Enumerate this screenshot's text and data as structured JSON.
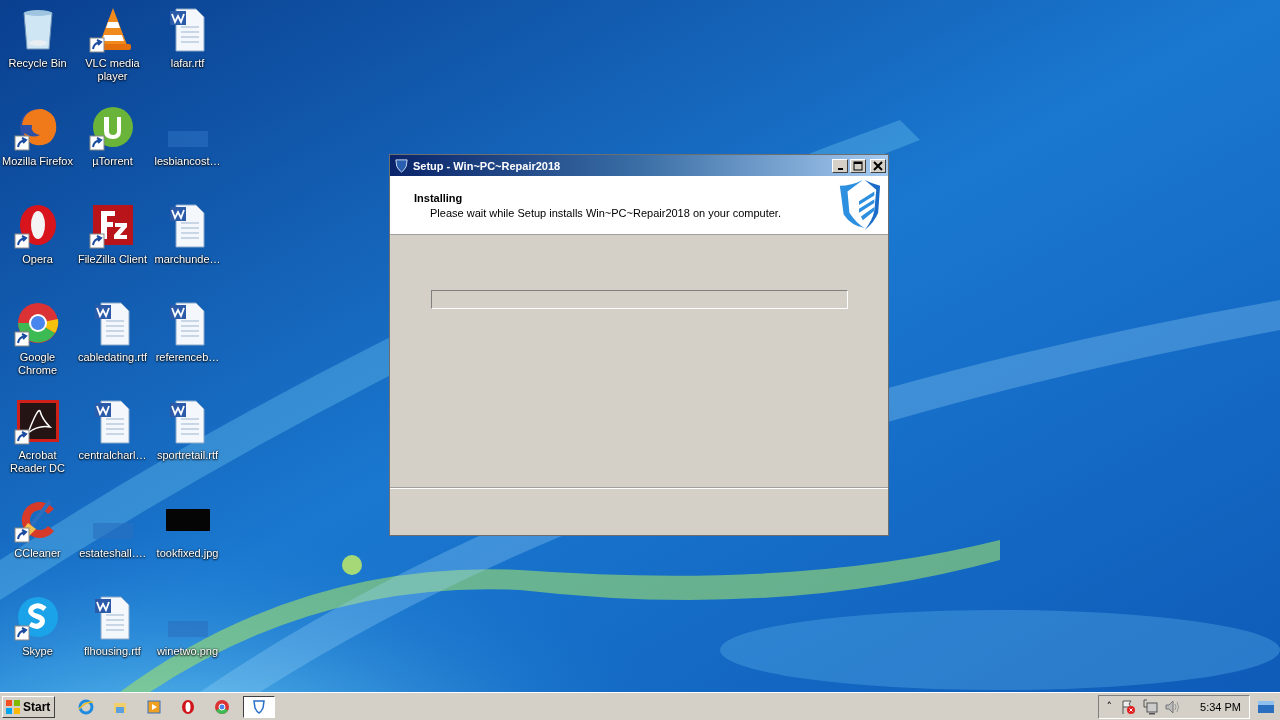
{
  "desktop_icons": [
    {
      "label": "Recycle Bin",
      "kind": "recycle",
      "shortcut": false
    },
    {
      "label": "VLC media player",
      "kind": "cone",
      "shortcut": true
    },
    {
      "label": "lafar.rtf",
      "kind": "document",
      "shortcut": false
    },
    {
      "label": "Mozilla Firefox",
      "kind": "firefox",
      "shortcut": true
    },
    {
      "label": "µTorrent",
      "kind": "torrent",
      "shortcut": true
    },
    {
      "label": "lesbiancost…",
      "kind": "blank",
      "shortcut": false
    },
    {
      "label": "Opera",
      "kind": "opera",
      "shortcut": true
    },
    {
      "label": "FileZilla Client",
      "kind": "filezilla",
      "shortcut": true
    },
    {
      "label": "marchunde…",
      "kind": "document",
      "shortcut": false
    },
    {
      "label": "Google Chrome",
      "kind": "chrome",
      "shortcut": true
    },
    {
      "label": "cabledating.rtf",
      "kind": "document",
      "shortcut": false
    },
    {
      "label": "referenceb…",
      "kind": "document",
      "shortcut": false
    },
    {
      "label": "Acrobat Reader DC",
      "kind": "acrobat",
      "shortcut": true
    },
    {
      "label": "centralcharl…",
      "kind": "document",
      "shortcut": false
    },
    {
      "label": "sportretail.rtf",
      "kind": "document",
      "shortcut": false
    },
    {
      "label": "CCleaner",
      "kind": "ccleaner",
      "shortcut": true
    },
    {
      "label": "estateshall….",
      "kind": "blank",
      "shortcut": false
    },
    {
      "label": "tookfixed.jpg",
      "kind": "dark-image",
      "shortcut": false
    },
    {
      "label": "Skype",
      "kind": "skype",
      "shortcut": true
    },
    {
      "label": "flhousing.rtf",
      "kind": "document",
      "shortcut": false
    },
    {
      "label": "winetwo.png",
      "kind": "blank",
      "shortcut": false
    }
  ],
  "window": {
    "title": "Setup - Win~PC~Repair2018",
    "heading": "Installing",
    "subtitle": "Please wait while Setup installs Win~PC~Repair2018 on your computer.",
    "progress": {
      "level": 0
    }
  },
  "taskbar": {
    "start": "Start",
    "pinned": [
      {
        "kind": "ie",
        "selected": false
      },
      {
        "kind": "folder",
        "selected": false
      },
      {
        "kind": "player",
        "selected": false
      },
      {
        "kind": "opera",
        "selected": false
      },
      {
        "kind": "chrome",
        "selected": false
      },
      {
        "kind": "shield",
        "selected": true
      }
    ],
    "tray": {
      "chevron": "˄",
      "clock": "5:34 PM"
    }
  }
}
